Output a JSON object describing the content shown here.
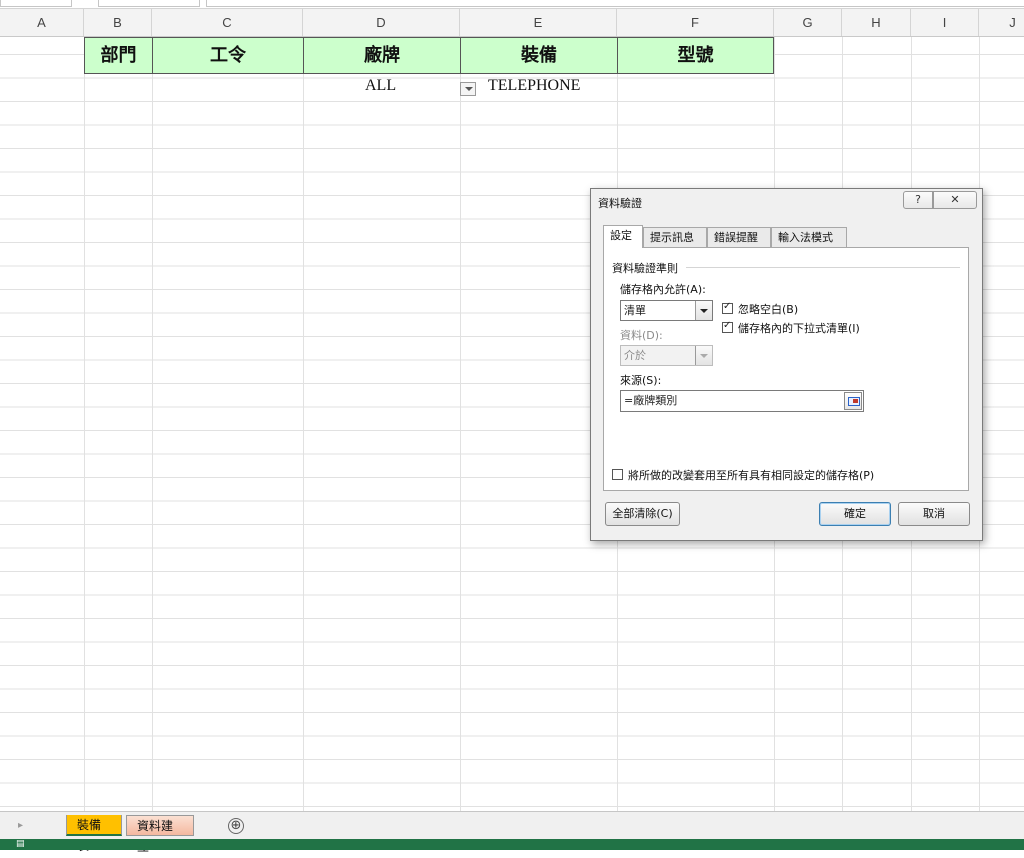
{
  "columns": [
    "A",
    "B",
    "C",
    "D",
    "E",
    "F",
    "G",
    "H",
    "I",
    "J"
  ],
  "header_row": [
    "部門",
    "工令",
    "廠牌",
    "裝備",
    "型號"
  ],
  "row2": {
    "brand": "ALL",
    "equipment": "TELEPHONE"
  },
  "sheet_tabs": [
    "裝備表",
    "資料建立"
  ],
  "add_sheet_icon": "⊕",
  "dialog": {
    "title": "資料驗證",
    "help_label": "?",
    "close_label": "✕",
    "tabs": [
      "設定",
      "提示訊息",
      "錯誤提醒",
      "輸入法模式"
    ],
    "group_title": "資料驗證準則",
    "allow_label": "儲存格內允許(A):",
    "allow_value": "清單",
    "ignore_blank_label": "忽略空白(B)",
    "ignore_blank_checked": true,
    "dropdown_label": "儲存格內的下拉式清單(I)",
    "dropdown_checked": true,
    "data_label": "資料(D):",
    "data_value": "介於",
    "source_label": "來源(S):",
    "source_value": "=廠牌類別",
    "apply_all_label": "將所做的改變套用至所有具有相同設定的儲存格(P)",
    "apply_all_checked": false,
    "clear_all_label": "全部清除(C)",
    "ok_label": "確定",
    "cancel_label": "取消"
  }
}
